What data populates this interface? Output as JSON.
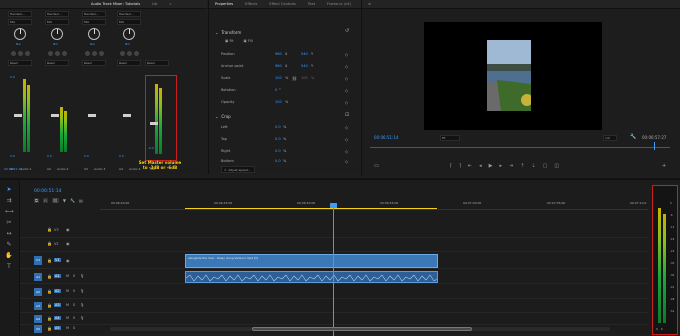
{
  "audio_mixer": {
    "tabs": [
      "Audio Track Mixer: Tutorials",
      "Lib"
    ],
    "channels": [
      {
        "effect": "Hexdeci...",
        "mode": "Mix",
        "send": "Nul",
        "read": "Read",
        "name": "A1",
        "label": "Audio 1",
        "value": "0.0"
      },
      {
        "effect": "Hexdeci...",
        "mode": "Mix",
        "send": "Nul",
        "read": "Read",
        "name": "A2",
        "label": "Audio 2",
        "value": "0.0"
      },
      {
        "effect": "Hexdeci...",
        "mode": "Mix",
        "send": "Nul",
        "read": "Read",
        "name": "A3",
        "label": "Audio 3",
        "value": "0.0"
      },
      {
        "effect": "Hexdeci...",
        "mode": "Mix",
        "send": "Nul",
        "read": "Read",
        "name": "A4",
        "label": "Audio 4",
        "value": "0.0"
      },
      {
        "effect": "",
        "mode": "Mix",
        "send": "",
        "read": "Read",
        "name": "Mix",
        "label": "Mix",
        "value": "-6.0"
      }
    ],
    "timecode": "00:06:51:14",
    "annotation": "Set Master volume\nto -3dB or -6dB"
  },
  "properties": {
    "tabs": [
      "Properties",
      "Effects",
      "Effect Controls",
      "Text",
      "Frame.io (v4)"
    ],
    "transform_title": "Transform",
    "fit": "Fit",
    "fill": "Fill",
    "rows": [
      {
        "label": "Position",
        "v1": "960",
        "u1": "X",
        "v2": "540",
        "u2": "Y"
      },
      {
        "label": "Anchor point",
        "v1": "960",
        "u1": "X",
        "v2": "540",
        "u2": "Y"
      },
      {
        "label": "Scale",
        "v1": "100",
        "u1": "%",
        "v2": "100",
        "u2": "%"
      },
      {
        "label": "Rotation",
        "v1": "0",
        "u1": "°",
        "v2": "",
        "u2": ""
      },
      {
        "label": "Opacity",
        "v1": "100",
        "u1": "%",
        "v2": "",
        "u2": ""
      }
    ],
    "crop_title": "Crop",
    "crop_rows": [
      {
        "label": "Left",
        "v": "0.0",
        "u": "%"
      },
      {
        "label": "Top",
        "v": "0.0",
        "u": "%"
      },
      {
        "label": "Right",
        "v": "0.0",
        "u": "%"
      },
      {
        "label": "Bottom",
        "v": "0.0",
        "u": "%"
      }
    ],
    "footer_button": "Adjust speed..."
  },
  "program": {
    "timecode": "00:06:51:14",
    "fit": "Fit",
    "quality": "1/2",
    "duration": "00:06:57:27"
  },
  "timeline": {
    "timecode": "00:06:51:14",
    "ruler": [
      "00:06:40:00",
      "00:06:45:00",
      "00:06:50:00",
      "00:06:55:00",
      "00:07:00:00",
      "00:07:05:00",
      "00:07:10:0"
    ],
    "video_tracks": [
      "V3",
      "V2",
      "V1"
    ],
    "audio_tracks": [
      "A1",
      "A2",
      "A3",
      "A4",
      "A5"
    ],
    "clip_label": "alongside the river - Daisy (Long Version).mp4 [V]"
  },
  "master_meter": {
    "scale": [
      "0",
      "-6",
      "-12",
      "-18",
      "-24",
      "-30",
      "-36",
      "-42",
      "-48",
      "-54"
    ],
    "buttons": [
      "S",
      "S"
    ]
  },
  "colors": {
    "accent": "#3d9bff",
    "highlight": "#c8201e",
    "clip": "#2f6fb2",
    "annotation": "#f2d21b"
  }
}
